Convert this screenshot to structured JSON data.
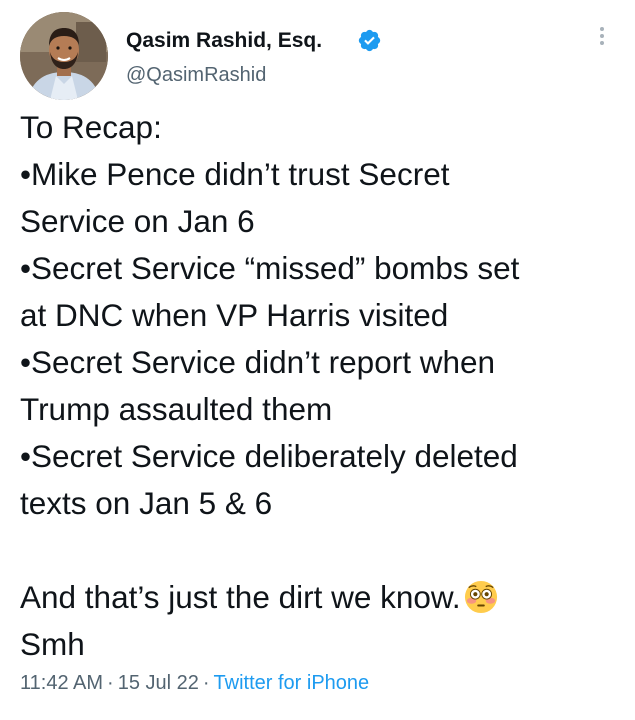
{
  "author": {
    "name": "Qasim Rashid, Esq.",
    "handle": "@QasimRashid",
    "verified": true
  },
  "tweet": {
    "lines": [
      "To Recap:",
      "•Mike Pence didn’t trust Secret",
      "Service on Jan 6",
      "•Secret Service “missed” bombs set",
      "at DNC when VP Harris visited",
      "•Secret Service didn’t report when",
      "Trump assaulted them",
      "•Secret Service deliberately deleted",
      "texts on Jan 5 & 6"
    ],
    "closing_line": "And that’s just the dirt we know.",
    "closing_emoji": "flushed-face-icon",
    "last_line": "Smh"
  },
  "meta": {
    "time": "11:42 AM",
    "separator": "·",
    "date": "15 Jul 22",
    "source": "Twitter for iPhone"
  },
  "colors": {
    "text": "#0f1419",
    "secondary": "#536471",
    "accent": "#1d9bf0"
  }
}
